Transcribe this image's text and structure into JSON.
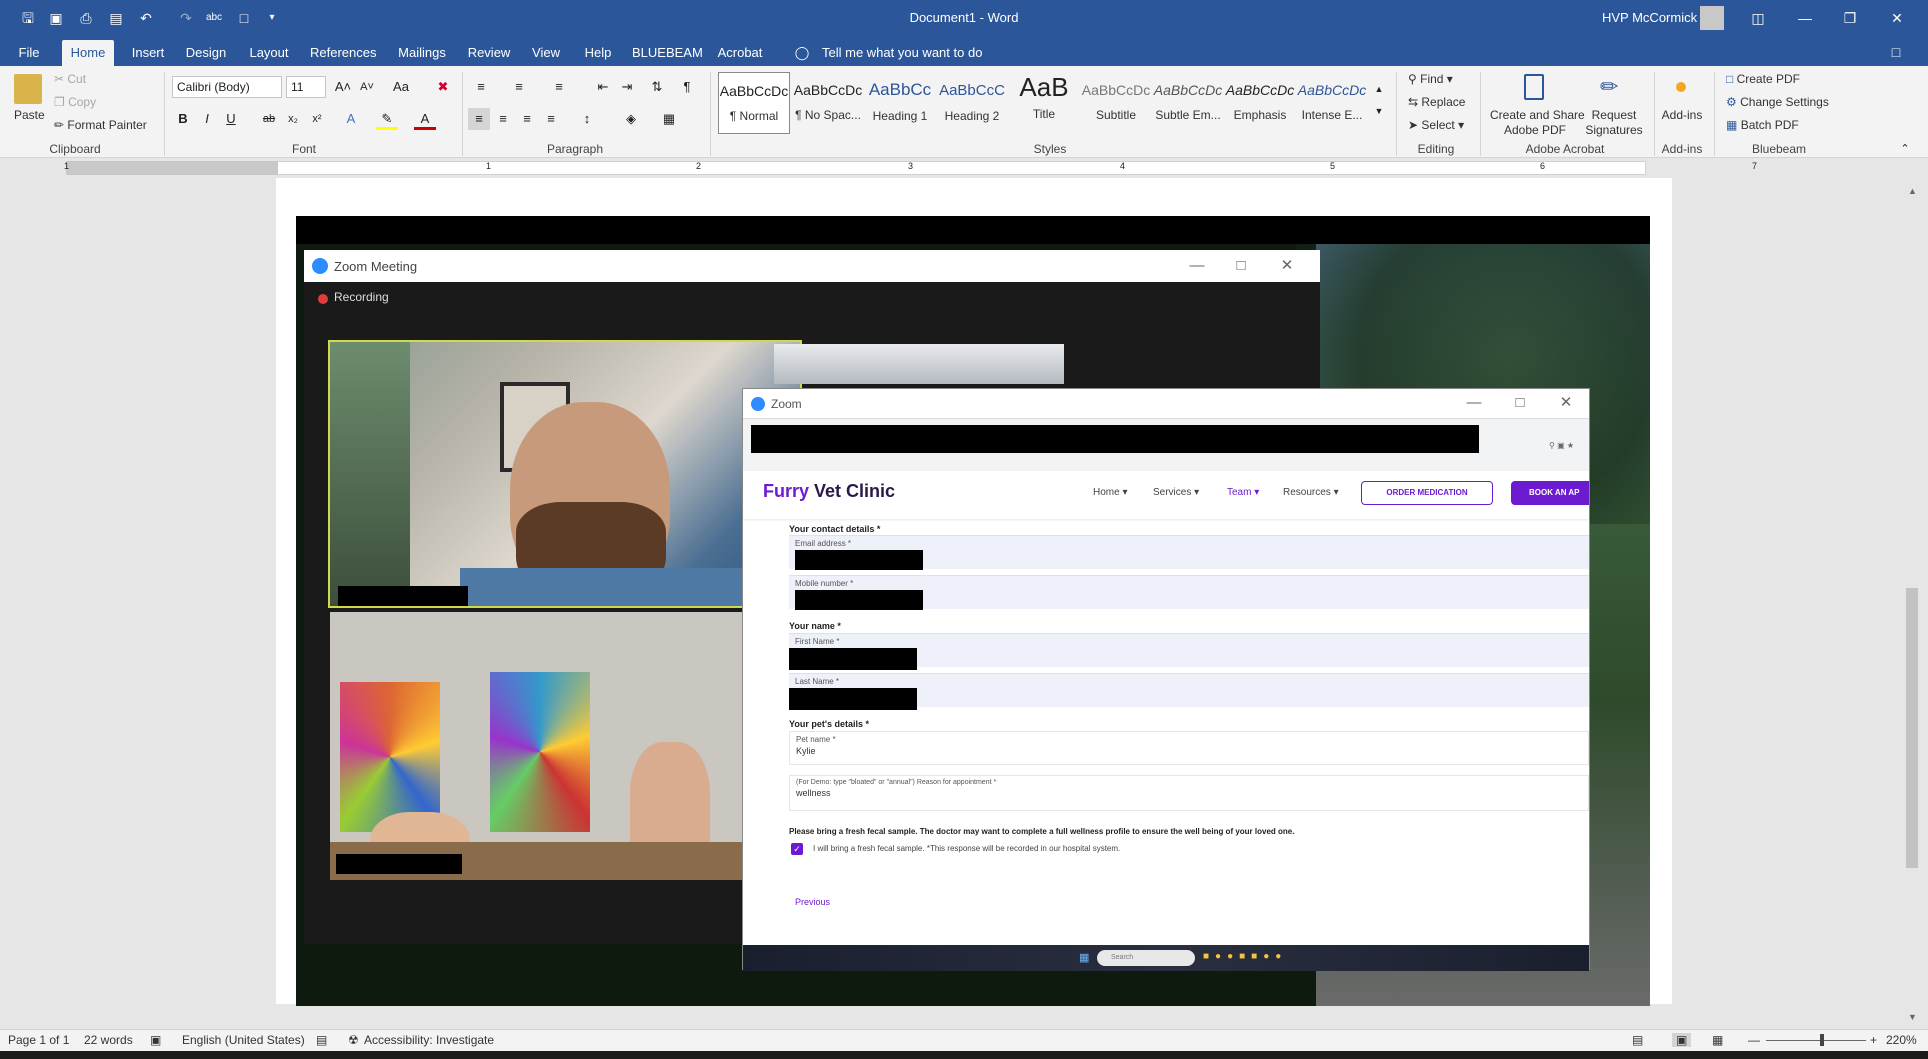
{
  "title_bar": {
    "doc_title": "Document1  -  Word",
    "user_name": "HVP McCormick"
  },
  "tabs": [
    "File",
    "Home",
    "Insert",
    "Design",
    "Layout",
    "References",
    "Mailings",
    "Review",
    "View",
    "Help",
    "BLUEBEAM",
    "Acrobat"
  ],
  "tell_me": "Tell me what you want to do",
  "clipboard": {
    "paste": "Paste",
    "cut": "Cut",
    "copy": "Copy",
    "format_painter": "Format Painter",
    "label": "Clipboard"
  },
  "font": {
    "name": "Calibri (Body)",
    "size": "11",
    "label": "Font",
    "case": "Aa"
  },
  "paragraph": {
    "label": "Paragraph"
  },
  "styles": {
    "label": "Styles",
    "items": [
      {
        "preview": "AaBbCcDc",
        "name": "¶ Normal"
      },
      {
        "preview": "AaBbCcDc",
        "name": "¶ No Spac..."
      },
      {
        "preview": "AaBbCc",
        "name": "Heading 1"
      },
      {
        "preview": "AaBbCcC",
        "name": "Heading 2"
      },
      {
        "preview": "AaB",
        "name": "Title"
      },
      {
        "preview": "AaBbCcDc",
        "name": "Subtitle"
      },
      {
        "preview": "AaBbCcDc",
        "name": "Subtle Em..."
      },
      {
        "preview": "AaBbCcDc",
        "name": "Emphasis"
      },
      {
        "preview": "AaBbCcDc",
        "name": "Intense E..."
      }
    ]
  },
  "editing": {
    "find": "Find",
    "replace": "Replace",
    "select": "Select",
    "label": "Editing"
  },
  "acrobat": {
    "create_share": "Create and Share",
    "adobe_pdf": "Adobe PDF",
    "request": "Request",
    "signatures": "Signatures",
    "label": "Adobe Acrobat"
  },
  "addins": {
    "name": "Add-ins",
    "label": "Add-ins"
  },
  "bluebeam": {
    "create_pdf": "Create PDF",
    "change_settings": "Change Settings",
    "batch_pdf": "Batch PDF",
    "label": "Bluebeam"
  },
  "ruler_numbers": [
    "1",
    "1",
    "2",
    "3",
    "4",
    "5",
    "6",
    "7"
  ],
  "zoom_meeting": {
    "title": "Zoom Meeting",
    "recording": "Recording"
  },
  "zoom_share": {
    "title": "Zoom"
  },
  "site": {
    "brand_a": "Furry",
    "brand_b": " Vet Clinic",
    "nav": [
      "Home",
      "Services",
      "Team",
      "Resources"
    ],
    "order_btn": "ORDER MEDICATION",
    "book_btn": "BOOK AN AP",
    "contact_heading": "Your contact details *",
    "email_label": "Email address  *",
    "mobile_label": "Mobile number  *",
    "name_heading": "Your name *",
    "first_label": "First Name  *",
    "last_label": "Last Name  *",
    "pet_heading": "Your pet's details *",
    "pet_label": "Pet name  *",
    "pet_value": "Kylie",
    "reason_label": "(For Demo: type \"bloated\" or \"annual\") Reason for appointment  *",
    "reason_value": "wellness",
    "notice": "Please bring a fresh fecal sample. The doctor may want to complete a full wellness profile to ensure the well being of your loved one.",
    "checkbox_text": "I will bring a fresh fecal sample. *This response will be recorded in our hospital system.",
    "previous": "Previous",
    "search_placeholder": "Search"
  },
  "status": {
    "page": "Page 1 of 1",
    "words": "22 words",
    "language": "English (United States)",
    "accessibility": "Accessibility: Investigate",
    "zoom": "220%"
  },
  "colors": {
    "word_blue": "#2b579a",
    "brand_purple": "#6c1bd1",
    "highlight": "#cfd94a"
  }
}
